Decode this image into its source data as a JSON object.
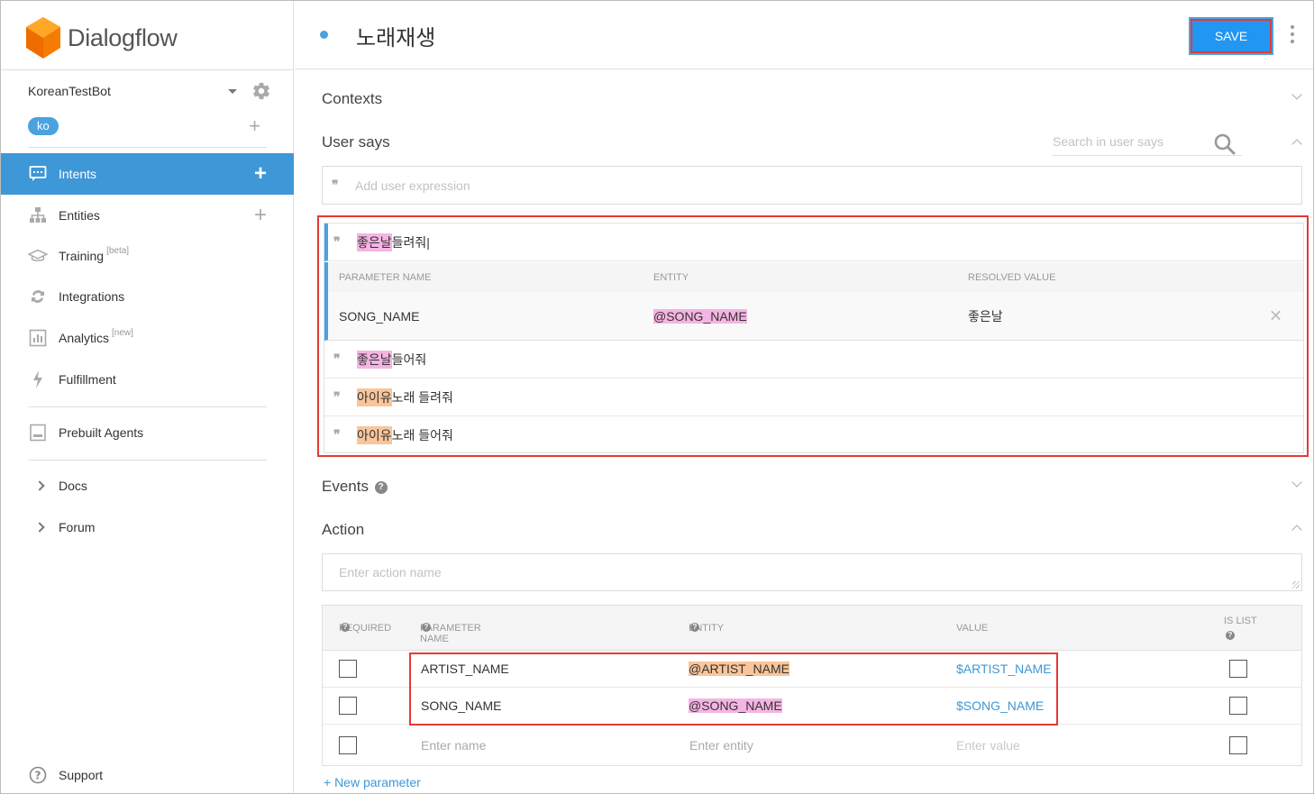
{
  "app": {
    "logo_text": "Dialogflow"
  },
  "agent": {
    "name": "KoreanTestBot",
    "language": "ko"
  },
  "nav": {
    "intents": "Intents",
    "entities": "Entities",
    "training": "Training",
    "training_badge": "[beta]",
    "integrations": "Integrations",
    "analytics": "Analytics",
    "analytics_badge": "[new]",
    "fulfillment": "Fulfillment",
    "prebuilt": "Prebuilt Agents",
    "docs": "Docs",
    "forum": "Forum",
    "support": "Support"
  },
  "header": {
    "title": "노래재생",
    "save_label": "SAVE"
  },
  "sections": {
    "contexts": "Contexts",
    "user_says": "User says",
    "events": "Events",
    "action": "Action"
  },
  "user_says": {
    "search_placeholder": "Search in user says",
    "add_placeholder": "Add user expression",
    "expressions": [
      {
        "entity": "좋은날",
        "rest": " 들려줘",
        "color": "pink"
      },
      {
        "entity": "좋은날",
        "rest": " 들어줘",
        "color": "pink"
      },
      {
        "entity": "아이유",
        "rest": " 노래 들려줘",
        "color": "orange"
      },
      {
        "entity": "아이유",
        "rest": " 노래 들어줘",
        "color": "orange"
      }
    ],
    "param_headers": {
      "name": "PARAMETER NAME",
      "entity": "ENTITY",
      "resolved": "RESOLVED VALUE"
    },
    "param_row": {
      "name": "SONG_NAME",
      "entity": "@SONG_NAME",
      "resolved": "좋은날"
    }
  },
  "action": {
    "placeholder": "Enter action name",
    "headers": {
      "required": "REQUIRED",
      "param_name": "PARAMETER NAME",
      "entity": "ENTITY",
      "value": "VALUE",
      "is_list": "IS LIST"
    },
    "rows": [
      {
        "name": "ARTIST_NAME",
        "entity": "@ARTIST_NAME",
        "value": "$ARTIST_NAME"
      },
      {
        "name": "SONG_NAME",
        "entity": "@SONG_NAME",
        "value": "$SONG_NAME"
      }
    ],
    "empty_row": {
      "name": "Enter name",
      "entity": "Enter entity",
      "value": "Enter value"
    },
    "new_parameter": "+ New parameter"
  },
  "colors": {
    "accent": "#3e97d6",
    "save": "#2196f3",
    "highlight_pink": "#f5b4e3",
    "highlight_orange": "#f9c59a",
    "annotation_red": "#e53935"
  }
}
